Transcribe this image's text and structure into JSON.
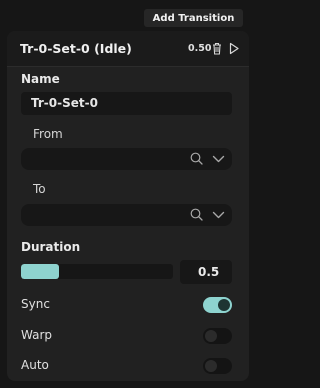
{
  "toolbar": {
    "add_transition_label": "Add Transition"
  },
  "transition": {
    "title": "Tr-0-Set-0 (Idle)",
    "duration_display": "0.50"
  },
  "fields": {
    "name_label": "Name",
    "name_value": "Tr-0-Set-0",
    "from_label": "From",
    "from_value": "",
    "to_label": "To",
    "to_value": "",
    "duration_label": "Duration",
    "duration_value": "0.5",
    "duration_fill_fraction": 0.25
  },
  "toggles": [
    {
      "label": "Sync",
      "on": true
    },
    {
      "label": "Warp",
      "on": false
    },
    {
      "label": "Auto",
      "on": false
    }
  ],
  "colors": {
    "accent": "#8ed3cf",
    "panel": "#212121",
    "field": "#171717"
  }
}
